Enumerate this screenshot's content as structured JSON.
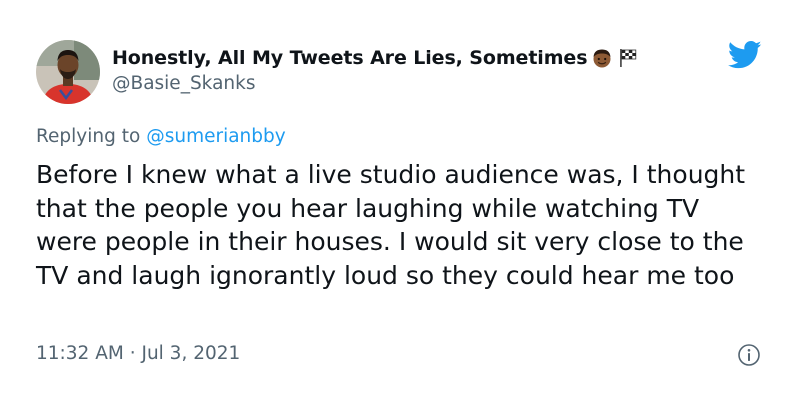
{
  "tweet": {
    "display_name": "Honestly, All My Tweets Are Lies, Sometimes",
    "emojis": [
      "man-face-emoji",
      "checkered-flag-emoji"
    ],
    "handle": "@Basie_Skanks",
    "replying_prefix": "Replying to",
    "replying_to": "@sumerianbby",
    "text": "Before I knew what a live studio audience was, I thought that the people you hear laughing while watching TV were people in their houses. I would sit very close to the TV and laugh ignorantly loud so they could hear me too",
    "time": "11:32 AM",
    "separator": "·",
    "date": "Jul 3, 2021",
    "icons": {
      "brand": "twitter-bird-icon",
      "info": "info-icon"
    }
  },
  "colors": {
    "text_primary": "#0f1419",
    "text_secondary": "#536471",
    "link": "#1d9bf0",
    "brand": "#1d9bf0",
    "background": "#ffffff"
  }
}
